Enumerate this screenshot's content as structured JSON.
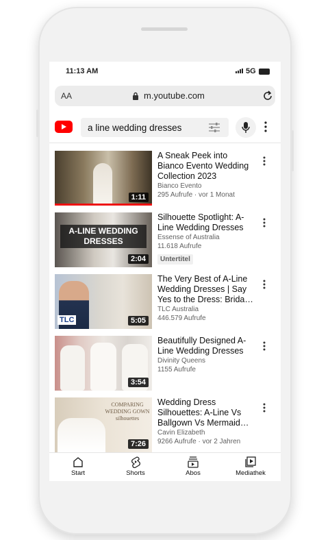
{
  "status_bar": {
    "time": "11:13 AM",
    "network": "5G"
  },
  "browser": {
    "text_size_label": "AA",
    "url": "m.youtube.com"
  },
  "youtube": {
    "search_query": "a line wedding dresses",
    "results": [
      {
        "title": "A Sneak Peek into Bianco Evento Wedding Collection 2023",
        "channel": "Bianco Evento",
        "stats": "295 Aufrufe · vor 1 Monat",
        "duration": "1:11",
        "watched_fraction": 1.0
      },
      {
        "title": "Silhouette Spotlight: A-Line Wedding Dresses",
        "channel": "Essense of Australia",
        "stats": "11.618 Aufrufe",
        "duration": "2:04",
        "badge": "Untertitel",
        "thumb_text": "A-LINE WEDDING DRESSES"
      },
      {
        "title": "The Very Best of A-Line Wedding Dresses | Say Yes to the Dress: Brida…",
        "channel": "TLC Australia",
        "stats": "446.579 Aufrufe",
        "duration": "5:05",
        "thumb_text": "TLC"
      },
      {
        "title": "Beautifully Designed A-Line Wedding Dresses",
        "channel": "Divinity Queens",
        "stats": "1155 Aufrufe",
        "duration": "3:54"
      },
      {
        "title": "Wedding Dress Silhouettes: A-Line Vs Ballgown Vs Mermaid…",
        "channel": "Cavin Elizabeth",
        "stats": "9266 Aufrufe · vor 2 Jahren",
        "duration": "7:26",
        "thumb_text": "COMPARING WEDDING GOWN silhouettes"
      }
    ]
  },
  "bottom_nav": [
    {
      "label": "Start",
      "icon": "home-icon"
    },
    {
      "label": "Shorts",
      "icon": "shorts-icon"
    },
    {
      "label": "Abos",
      "icon": "subscriptions-icon"
    },
    {
      "label": "Mediathek",
      "icon": "library-icon"
    }
  ],
  "colors": {
    "youtube_red": "#FF0000",
    "watched_progress": "#E11111"
  }
}
